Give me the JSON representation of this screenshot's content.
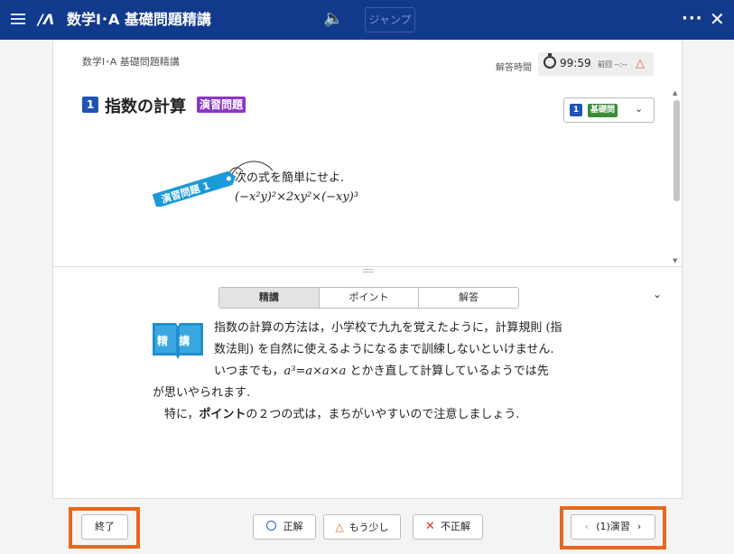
{
  "app": {
    "title": "数学Ⅰ･A 基礎問題精講",
    "jump_label": "ジャンプ"
  },
  "sheet": {
    "breadcrumb": "数学Ⅰ･A 基礎問題精講",
    "timer_label": "解答時間",
    "timer_value": "99:59",
    "prev_label": "前回 --:--",
    "chapter_number": "1",
    "chapter_title": "指数の計算",
    "chapter_tag": "演習問題",
    "level_number": "1",
    "level_label": "基礎問",
    "ribbon_label": "演習問題 1",
    "problem_instruction": "次の式を簡単にせよ.",
    "problem_expression": "(−x²y)²×2xy²×(−xy)³"
  },
  "tabs": [
    {
      "label": "精講",
      "active": true
    },
    {
      "label": "ポイント",
      "active": false
    },
    {
      "label": "解答",
      "active": false
    }
  ],
  "explanation": {
    "book_label": "精 講",
    "line1": "指数の計算の方法は，小学校で九九を覚えたように，計算規則 (指",
    "line2": "数法則) を自然に使えるようになるまで訓練しないといけません.",
    "line3_a": "いつまでも，",
    "line3_math": "a³=a×a×a",
    "line3_b": " とかき直して計算しているようでは先",
    "line4": "が思いやられます.",
    "line5_a": "特に，",
    "line5_bold": "ポイント",
    "line5_b": "の２つの式は，まちがいやすいので注意しましょう."
  },
  "footer": {
    "end_label": "終了",
    "correct_label": "正解",
    "almost_label": "もう少し",
    "wrong_label": "不正解",
    "next_label": "(1)演習"
  },
  "colors": {
    "topbar": "#123a8c",
    "chapter_tag": "#8a35c7",
    "level_badge": "#3c8b39",
    "highlight": "#e8671c",
    "ribbon": "#1a9ad9"
  }
}
